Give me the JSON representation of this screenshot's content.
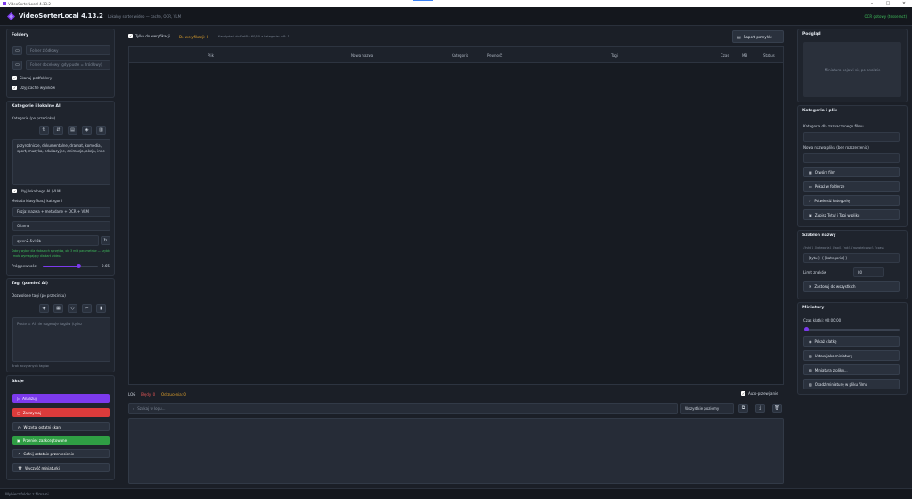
{
  "window": {
    "title": "VideoSorterLocal 4.13.2"
  },
  "header": {
    "title": "VideoSorterLocal 4.13.2",
    "subtitle": "Lokalny sorter wideo — cache, OCR, VLM",
    "status": "OCR gotowy (tesseract)"
  },
  "folders": {
    "title": "Foldery",
    "source_placeholder": "Folder źródłowy",
    "target_placeholder": "Folder docelowy (gdy puste = źródłowy)",
    "scan_subfolders": "Skanuj podfoldery",
    "use_cache": "Użyj cache wyników"
  },
  "categories": {
    "title": "Kategorie i lokalne AI",
    "label": "Kategorie (po przecinku)",
    "text": "przyrodnicze, dokumentalne, dramat, komedia, sport, muzyka, edukacyjne, animacja, akcja, inne",
    "use_vlm": "Użyj lokalnego AI (VLM)",
    "method_label": "Metoda klasyfikacji kategorii",
    "method_value": "Fuzja: nazwa + metadane + OCR + VLM",
    "engine_value": "Ollama",
    "model_value": "qwen2.5vl:3b",
    "hint": "Dobry wybór dla słabszych sprzętów, ok. 3 mld parametrów — szybki i mało wymagający dla kart wideo.",
    "threshold_label": "Próg pewności",
    "threshold_value": "0.65",
    "threshold_level": 0.65
  },
  "tags": {
    "title": "Tagi (pamięć AI)",
    "label": "Dozwolone tagi (po przecinku)",
    "placeholder": "Puste = AI nie sugeruje tagów (tylko",
    "loaded": "Brak wczytanych tagów."
  },
  "actions": {
    "title": "Akcje",
    "analyze": "Analizuj",
    "stop": "Zatrzymaj",
    "load_scan": "Wczytaj ostatni skan",
    "move": "Przenieś zaakceptowane",
    "undo": "Cofnij ostatnie przeniesienie",
    "clear_thumbs": "Wyczyść miniaturki"
  },
  "toolbar": {
    "only_verify": "Tylko do weryfikacji",
    "to_verify": "Do weryfikacji: 0",
    "stats": "Kandydaci do SetFit: 60/50 • kategorie: ≥8: 1",
    "report": "Raport pomyłek"
  },
  "table": {
    "columns": [
      "Plik",
      "Nowa nazwa",
      "Kategoria",
      "Pewność",
      "Tagi",
      "Czas",
      "MB",
      "Status"
    ]
  },
  "log": {
    "label": "LOG",
    "errors": "Błędy: 0",
    "skipped": "Odrzucenia: 0",
    "autoscroll": "Auto-przewijanie",
    "search_placeholder": "Szukaj w logu...",
    "level": "Wszystkie poziomy"
  },
  "preview": {
    "title": "Podgląd",
    "placeholder": "Miniatura pojawi się po analizie"
  },
  "category_file": {
    "title": "Kategoria i plik",
    "cat_label": "Kategoria dla zaznaczonego filmu",
    "name_label": "Nowa nazwa pliku (bez rozszerzenia)",
    "open_film": "Otwórz film",
    "show_folder": "Pokaż w folderze",
    "confirm": "Potwierdź kategorię",
    "save_title": "Zapisz Tytuł i Tagi w pliku"
  },
  "name_template": {
    "title": "Szablon nazwy",
    "hint": "{tytul} {kategoria} {tagi} {rok} {rozdzielczosc} {czas}",
    "value": "{tytul} {{kategoria}}",
    "limit_label": "Limit znaków",
    "limit_value": "80",
    "apply": "Zastosuj do wszystkich"
  },
  "thumbs": {
    "title": "Miniatury",
    "frame_time": "Czas klatki: 00:00:00",
    "show_frame": "Pokaż klatkę",
    "set_thumb": "Ustaw jako miniaturę",
    "from_file": "Miniatura z pliku...",
    "embed": "Osadź miniaturę w pliku filmu"
  },
  "statusbar": {
    "text": "Wybierz folder z filmami."
  },
  "colors": {
    "accent": "#7c3aed",
    "stop": "#dc3b3b",
    "move": "#2f9e44",
    "warn": "#e0a12b",
    "error": "#e05555",
    "ok": "#3fbf5c"
  }
}
